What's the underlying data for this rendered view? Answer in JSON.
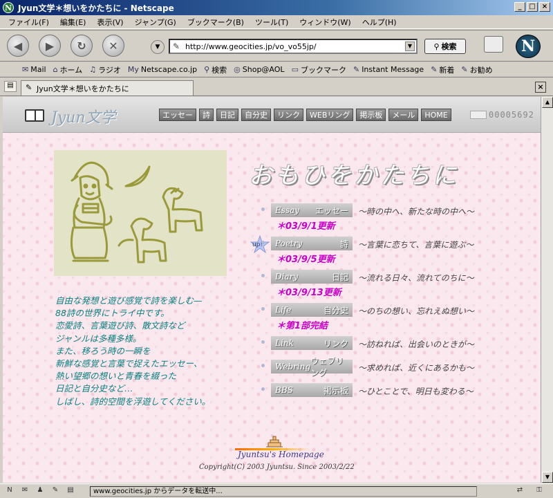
{
  "window": {
    "title": "Jyun文学＊想いをかたちに - Netscape",
    "app_icon": "N",
    "controls": [
      "_",
      "□",
      "×"
    ]
  },
  "menubar": [
    "ファイル(F)",
    "編集(E)",
    "表示(V)",
    "ジャンプ(G)",
    "ブックマーク(B)",
    "ツール(T)",
    "ウィンドウ(W)",
    "ヘルプ(H)"
  ],
  "nav": {
    "url": "http://www.geocities.jp/vo_vo55jp/",
    "search_label": "検索",
    "logo_letter": "N"
  },
  "personal_toolbar": [
    {
      "icon": "mail-icon",
      "glyph": "✉",
      "label": "Mail"
    },
    {
      "icon": "home-icon",
      "glyph": "⌂",
      "label": "ホーム"
    },
    {
      "icon": "radio-icon",
      "glyph": "♫",
      "label": "ラジオ"
    },
    {
      "icon": "netscape-icon",
      "glyph": "My",
      "label": "Netscape.co.jp"
    },
    {
      "icon": "search-icon",
      "glyph": "⚲",
      "label": "検索"
    },
    {
      "icon": "aol-icon",
      "glyph": "◎",
      "label": "Shop@AOL"
    },
    {
      "icon": "bookmark-icon",
      "glyph": "▭",
      "label": "ブックマーク"
    },
    {
      "icon": "link-icon",
      "glyph": "✎",
      "label": "Instant Message"
    },
    {
      "icon": "link-icon",
      "glyph": "✎",
      "label": "新着"
    },
    {
      "icon": "link-icon",
      "glyph": "✎",
      "label": "お勧め"
    }
  ],
  "tab": {
    "label": "Jyun文学＊想いをかたちに"
  },
  "site": {
    "logo": "Jyun文学",
    "nav": [
      "エッセー",
      "詩",
      "日記",
      "自分史",
      "リンク",
      "WEBリング",
      "掲示板",
      "メール",
      "HOME"
    ],
    "counter": "00005692",
    "main_title": "おもひをかたちに",
    "intro": [
      "自由な発想と遊び感覚で詩を楽しむ—",
      "88詩の世界にトライ中です。",
      "恋愛詩、言葉遊び詩、散文詩など",
      "ジャンルは多種多様。",
      "また、移ろう時の一瞬を",
      "新鮮な感覚と言葉で捉えたエッセー、",
      "熱い望郷の想いと青春を綴った",
      "日記と自分史など…",
      "しばし、詩的空間を浮遊してください。"
    ],
    "sections": [
      {
        "en": "Essay",
        "jp": "エッセー",
        "desc": "～時の中へ、新たな時の中へ～",
        "update": "＊03/9/1更新"
      },
      {
        "en": "Poetry",
        "jp": "詩",
        "desc": "～言葉に恋ちて、言葉に遊ぶ～",
        "update": "＊03/9/5更新"
      },
      {
        "en": "Diary",
        "jp": "日記",
        "desc": "～流れる日々、流れてのちに～",
        "update": "＊03/9/13更新"
      },
      {
        "en": "Life",
        "jp": "自分史",
        "desc": "～のちの想い、忘れえぬ想い～",
        "update": "＊第1部完結"
      },
      {
        "en": "Link",
        "jp": "リンク",
        "desc": "～訪ねれば、出会いのときが～"
      },
      {
        "en": "Webring",
        "jp": "ウェブリング",
        "desc": "～求めれば、近くにあるかも～"
      },
      {
        "en": "BBS",
        "jp": "掲示板",
        "desc": "～ひとことで、明日も変わる～"
      }
    ],
    "up_badge": "up!",
    "footer_name": "Jyuntsu's Homepage",
    "copyright": "Copyright(C) 2003 Jyuntsu. Since 2003/2/22"
  },
  "status": {
    "text": "www.geocities.jp からデータを転送中..."
  }
}
